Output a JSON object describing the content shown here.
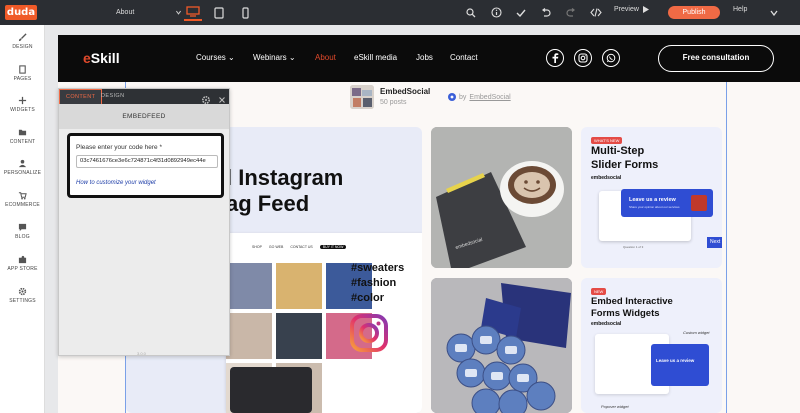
{
  "topbar": {
    "logo": "duda",
    "page_select": "About",
    "preview_label": "Preview",
    "publish_label": "Publish",
    "help_label": "Help"
  },
  "sidebar": {
    "items": [
      {
        "label": "DESIGN",
        "icon": "brush-icon"
      },
      {
        "label": "PAGES",
        "icon": "pages-icon"
      },
      {
        "label": "WIDGETS",
        "icon": "plus-icon"
      },
      {
        "label": "CONTENT",
        "icon": "folder-icon"
      },
      {
        "label": "PERSONALIZE",
        "icon": "person-icon"
      },
      {
        "label": "ECOMMERCE",
        "icon": "cart-icon"
      },
      {
        "label": "BLOG",
        "icon": "chat-icon"
      },
      {
        "label": "APP STORE",
        "icon": "puzzle-icon"
      },
      {
        "label": "SETTINGS",
        "icon": "gear-icon"
      }
    ]
  },
  "site": {
    "brand_first": "e",
    "brand_rest": "Skill",
    "nav": [
      {
        "label": "Courses ⌄",
        "active": false
      },
      {
        "label": "Webinars ⌄",
        "active": false
      },
      {
        "label": "About",
        "active": true
      },
      {
        "label": "eSkill media",
        "active": false
      },
      {
        "label": "Jobs",
        "active": false
      },
      {
        "label": "Contact",
        "active": false
      }
    ],
    "consult_label": "Free consultation",
    "feed": {
      "name": "EmbedSocial",
      "posts": "50 posts",
      "by_prefix": "by",
      "by_name": "EmbedSocial"
    },
    "tiles": {
      "instagram_title_1": "l Instagram",
      "instagram_title_2": "ag Feed",
      "hashtags": [
        "#sweaters",
        "#fashion",
        "#color"
      ],
      "mini_nav": [
        "SHOP",
        "GO WEB",
        "CONTACT US",
        "BUY IT NOW"
      ],
      "slider_badge": "WHAT'S NEW",
      "slider_title_1": "Multi-Step",
      "slider_title_2": "Slider Forms",
      "slider_brand": "embedsocial",
      "slider_card_title": "Leave us a review",
      "slider_card_sub": "Share your opinion about our services",
      "slider_next": "Next",
      "slider_question": "Question 1 of 3",
      "forms_badge": "NEW",
      "forms_title_1": "Embed Interactive",
      "forms_title_2": "Forms Widgets",
      "forms_brand": "embedsocial",
      "forms_card_title": "Leave us a review",
      "forms_note_1": "Custom widget",
      "forms_note_2": "Popover widget",
      "mug_brand": "embedsocial"
    }
  },
  "panel": {
    "tab_content": "CONTENT",
    "tab_design": "DESIGN",
    "title": "EMBEDFEED",
    "code_label": "Please enter your code here *",
    "code_value": "03c7461676ce3e6c724871c4f31d0892949ec44e",
    "link": "How to customize your widget",
    "footer": "3.0.0"
  }
}
